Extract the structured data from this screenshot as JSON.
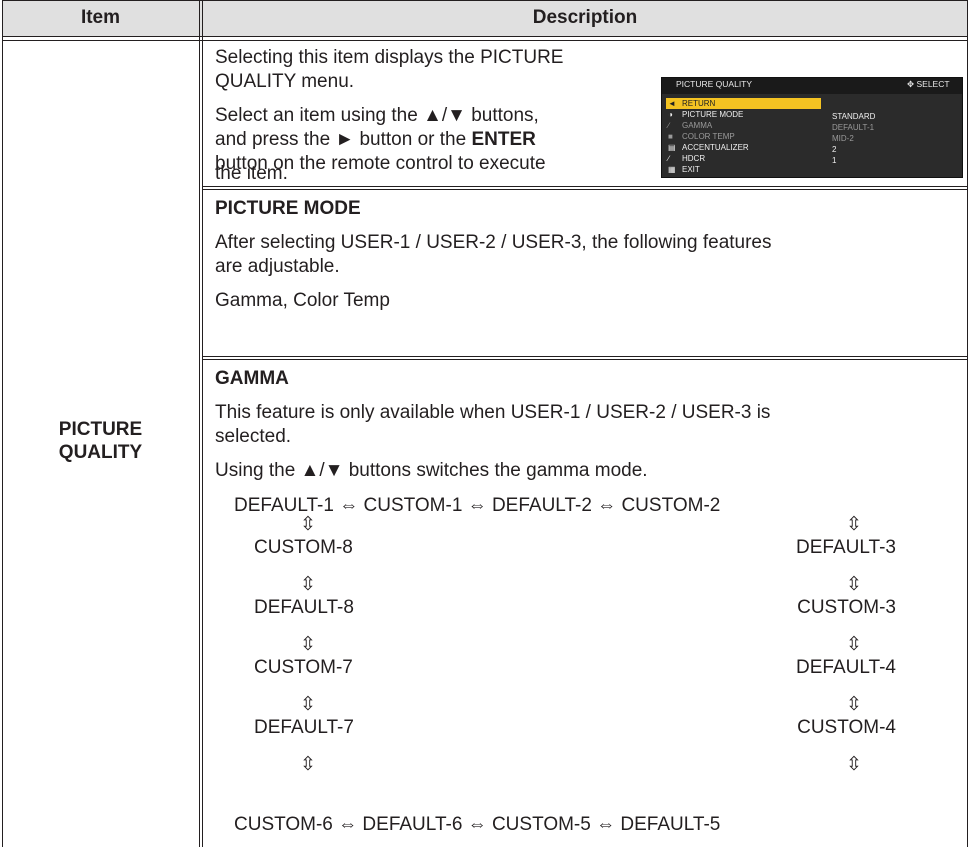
{
  "header": {
    "item": "Item",
    "description": "Description"
  },
  "item_label_line1": "PICTURE",
  "item_label_line2": "QUALITY",
  "intro": {
    "p1_line1": "Selecting this item displays the PICTURE",
    "p1_line2": "QUALITY menu.",
    "p2_line1": "Select an item using the ▲/▼ buttons,",
    "p2_line2_a": "and press the ► button or the ",
    "p2_line2_b": "ENTER",
    "p2_line3": "button on the remote control to execute",
    "p2_line4": "the item."
  },
  "menu": {
    "title": "PICTURE QUALITY",
    "select": "SELECT",
    "items": [
      {
        "label": "RETURN",
        "icon": "◄"
      },
      {
        "label": "PICTURE MODE",
        "icon": "◑"
      },
      {
        "label": "GAMMA",
        "icon": "∕"
      },
      {
        "label": "COLOR TEMP",
        "icon": "■"
      },
      {
        "label": "ACCENTUALIZER",
        "icon": "▤"
      },
      {
        "label": "HDCR",
        "icon": "∕"
      },
      {
        "label": "EXIT",
        "icon": "▦"
      }
    ],
    "values": [
      "STANDARD",
      "DEFAULT-1",
      "MID-2",
      "2",
      "1"
    ]
  },
  "picture_mode": {
    "heading": "PICTURE MODE",
    "line1": "After selecting USER-1 / USER-2 / USER-3, the following features",
    "line2": "are adjustable.",
    "line3": "Gamma, Color Temp"
  },
  "gamma": {
    "heading": "GAMMA",
    "line1": "This feature is only available when USER-1 / USER-2 / USER-3 is",
    "line2": "selected.",
    "line3": "Using the ▲/▼ buttons switches the gamma mode.",
    "top_row": "DEFAULT-1 ⇔ CUSTOM-1 ⇔ DEFAULT-2 ⇔ CUSTOM-2",
    "left_col": [
      "CUSTOM-8",
      "DEFAULT-8",
      "CUSTOM-7",
      "DEFAULT-7"
    ],
    "right_col": [
      "DEFAULT-3",
      "CUSTOM-3",
      "DEFAULT-4",
      "CUSTOM-4"
    ],
    "bottom_row": "CUSTOM-6 ⇔ DEFAULT-6 ⇔ CUSTOM-5 ⇔ DEFAULT-5",
    "vert_arrow": "⇳"
  }
}
